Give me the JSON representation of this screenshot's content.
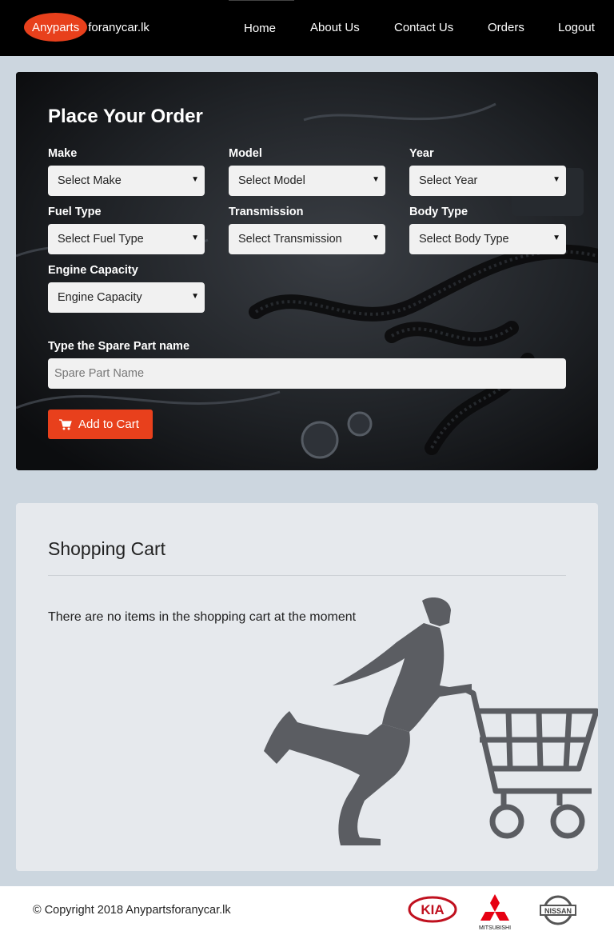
{
  "navbar": {
    "logo_highlight": "Anyparts",
    "logo_rest": "foranycar.lk",
    "links": [
      {
        "label": "Home"
      },
      {
        "label": "About Us"
      },
      {
        "label": "Contact Us"
      },
      {
        "label": "Orders"
      },
      {
        "label": "Logout"
      }
    ]
  },
  "order": {
    "title": "Place Your Order",
    "fields": [
      {
        "label": "Make",
        "value": "Select Make"
      },
      {
        "label": "Model",
        "value": "Select Model"
      },
      {
        "label": "Year",
        "value": "Select Year"
      },
      {
        "label": "Fuel Type",
        "value": "Select Fuel Type"
      },
      {
        "label": "Transmission",
        "value": "Select Transmission"
      },
      {
        "label": "Body Type",
        "value": "Select Body Type"
      },
      {
        "label": "Engine Capacity",
        "value": "Engine Capacity"
      }
    ],
    "spare_part_label": "Type the Spare Part name",
    "spare_part_placeholder": "Spare Part Name",
    "add_to_cart": "Add to Cart"
  },
  "cart": {
    "title": "Shopping Cart",
    "empty_message": "There are no items in the shopping cart at the moment"
  },
  "footer": {
    "copyright": "© Copyright 2018 Anypartsforanycar.lk",
    "brands": [
      {
        "name": "KIA",
        "icon": "kia-logo"
      },
      {
        "name": "MITSUBISHI",
        "icon": "mitsubishi-logo"
      },
      {
        "name": "NISSAN",
        "icon": "nissan-logo"
      }
    ]
  },
  "colors": {
    "accent": "#e8401c",
    "navbar": "#000000",
    "page_background": "#ccd6df",
    "cart_panel": "#e6e9ed"
  }
}
